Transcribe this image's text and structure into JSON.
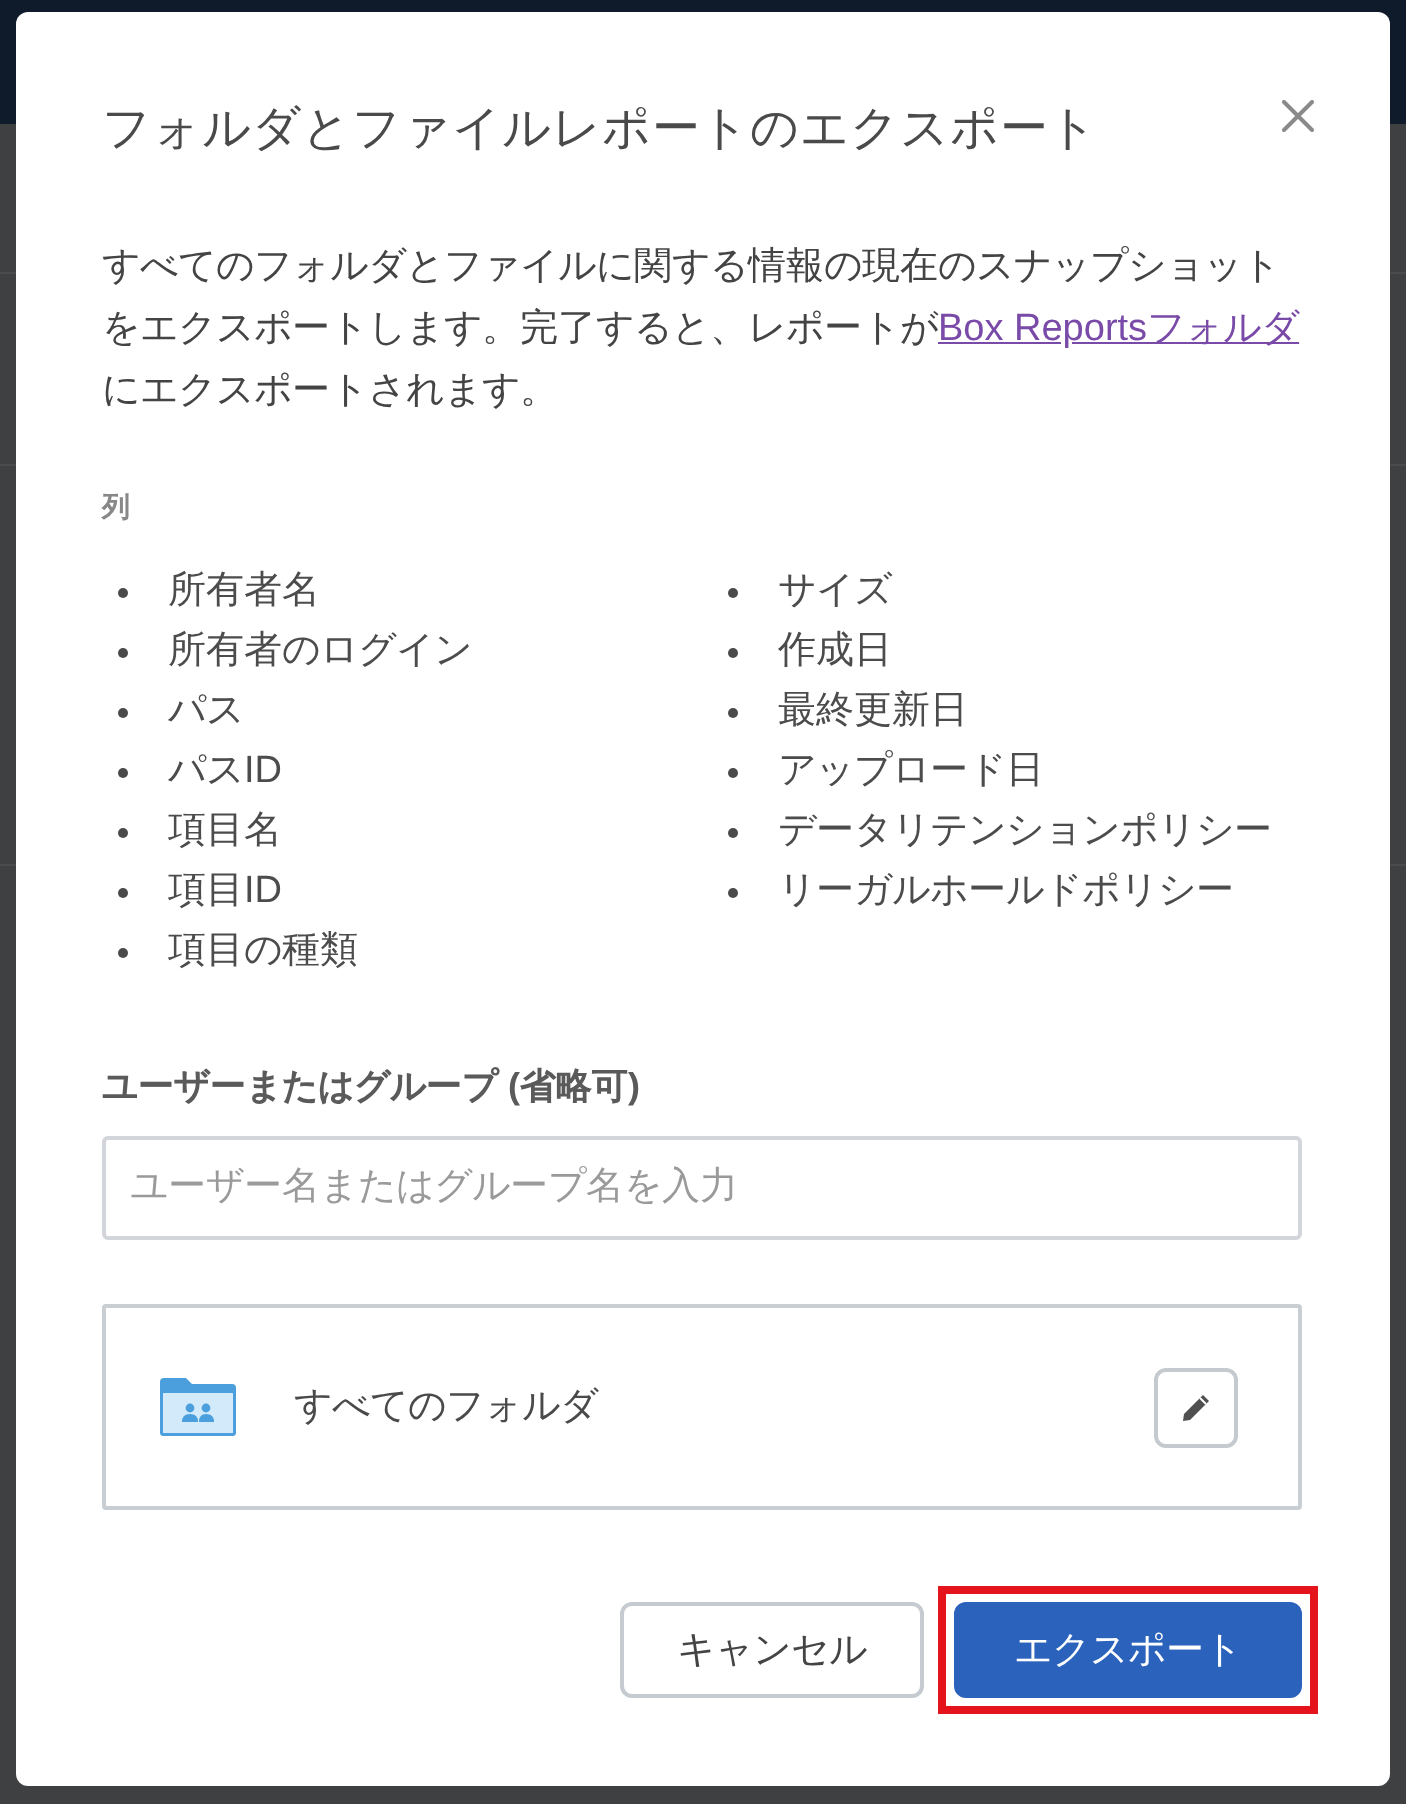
{
  "dialog": {
    "title": "フォルダとファイルレポートのエクスポート",
    "description": {
      "text_before_link": "すべてのフォルダとファイルに関する情報の現在のスナップショットをエクスポートします。完了すると、レポートが",
      "link": "Box Reportsフォルダ",
      "text_after_link": "にエクスポートされます。"
    },
    "columns": {
      "label": "列",
      "lists": [
        {
          "items": [
            "所有者名",
            "所有者のログイン",
            "パス",
            "パスID",
            "項目名",
            "項目ID",
            "項目の種類"
          ]
        },
        {
          "items": [
            "サイズ",
            "作成日",
            "最終更新日",
            "アップロード日",
            "データリテンションポリシー",
            "リーガルホールドポリシー"
          ]
        }
      ]
    },
    "user_or_group": {
      "label": "ユーザーまたはグループ (省略可)",
      "placeholder": "ユーザー名またはグループ名を入力"
    },
    "folder_selection": {
      "name": "すべてのフォルダ"
    },
    "buttons": [
      {
        "label": "キャンセル",
        "kind": "secondary",
        "highlighted": false
      },
      {
        "label": "エクスポート",
        "kind": "primary",
        "highlighted": true
      }
    ]
  }
}
